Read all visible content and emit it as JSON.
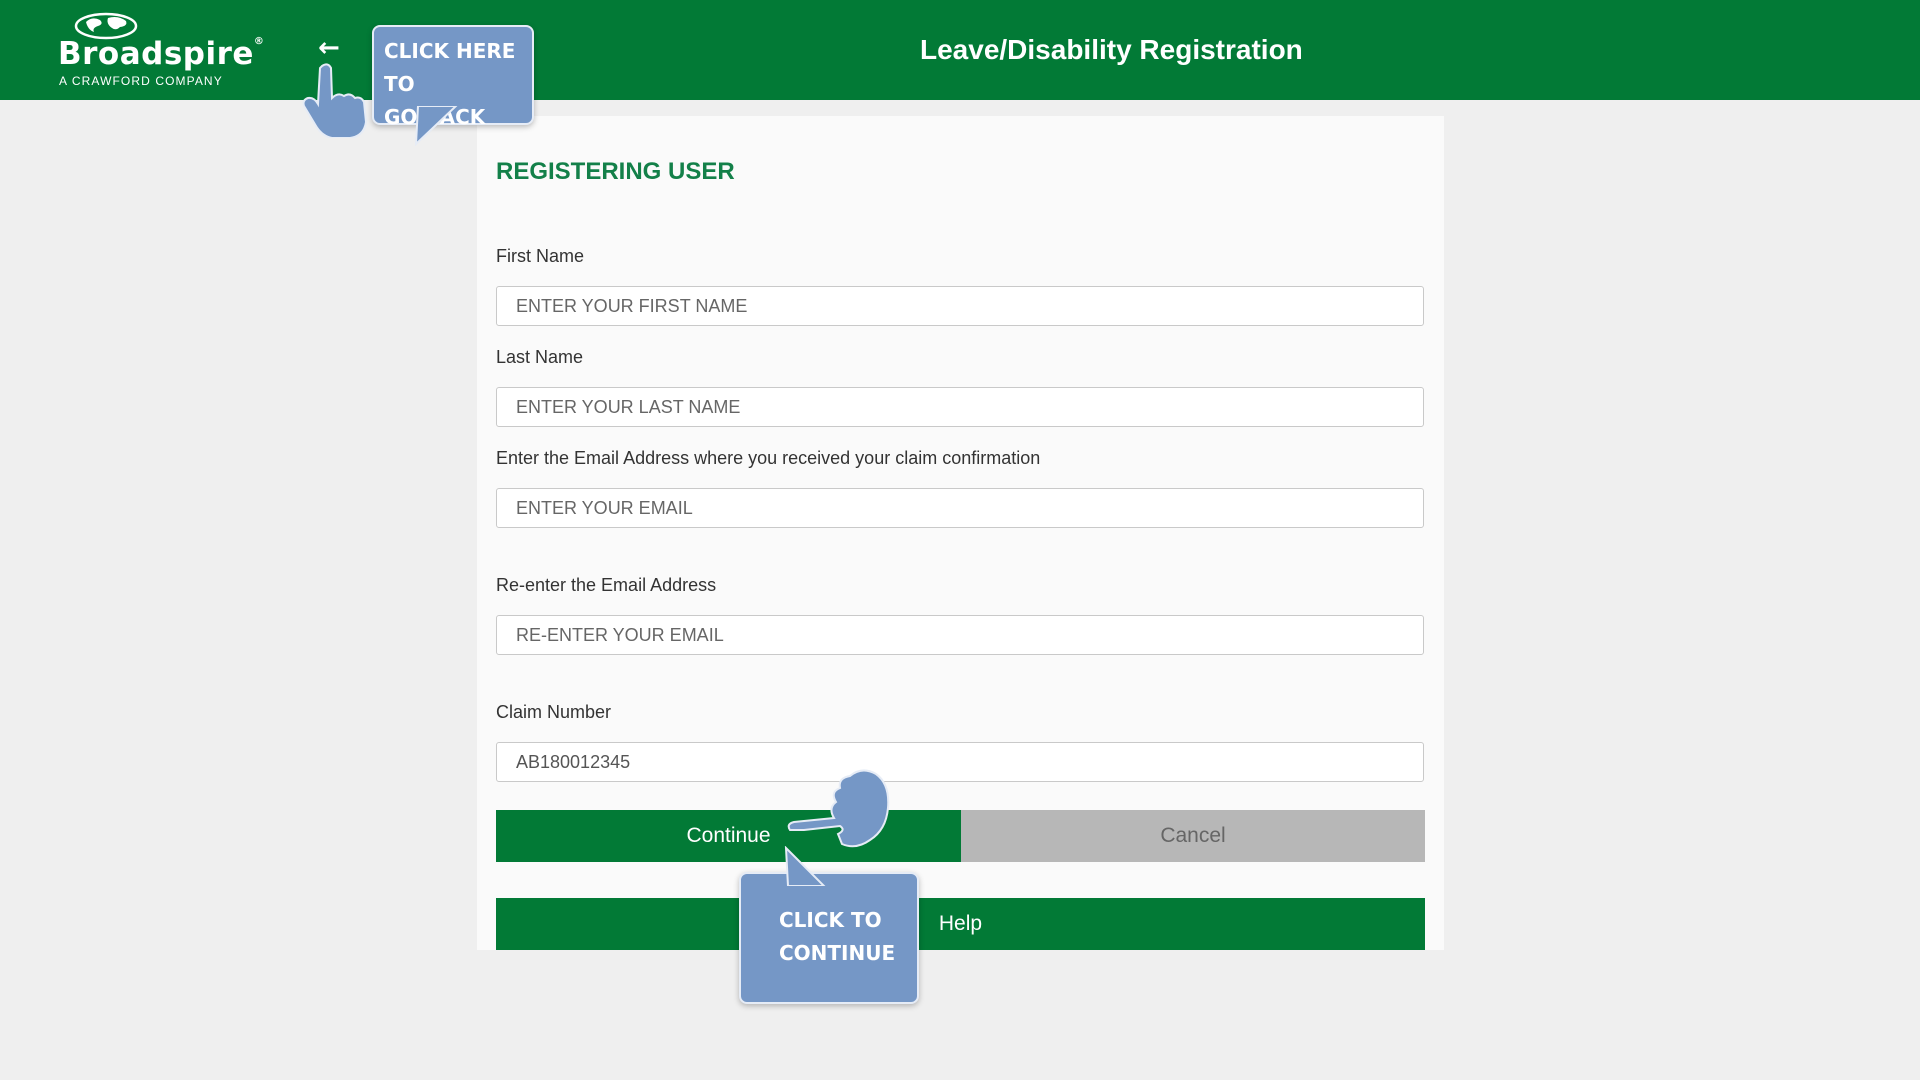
{
  "header": {
    "logo_name": "Broadspire",
    "logo_reg": "®",
    "logo_tagline": "A CRAWFORD COMPANY",
    "title": "Leave/Disability Registration",
    "back_icon": "arrow-left-icon",
    "brand_color": "#027a36"
  },
  "form": {
    "section_title": "REGISTERING USER",
    "fields": [
      {
        "label": "First Name",
        "placeholder": "ENTER YOUR FIRST NAME",
        "value": ""
      },
      {
        "label": "Last Name",
        "placeholder": "ENTER YOUR LAST NAME",
        "value": ""
      },
      {
        "label": "Enter the Email Address where you received your claim confirmation",
        "placeholder": "ENTER YOUR EMAIL",
        "value": ""
      },
      {
        "label": "Re-enter the Email Address",
        "placeholder": "RE-ENTER YOUR EMAIL",
        "value": ""
      },
      {
        "label": "Claim Number",
        "placeholder": "",
        "value": "AB180012345"
      }
    ],
    "buttons": {
      "continue": "Continue",
      "cancel": "Cancel",
      "help": "Help"
    }
  },
  "annotations": {
    "back_callout_line1": "CLICK HERE TO",
    "back_callout_line2": "GO BACK",
    "continue_callout_line1": "CLICK TO",
    "continue_callout_line2": "CONTINUE",
    "callout_color": "#7597c6",
    "pointer_icon": "pointing-hand-icon"
  }
}
